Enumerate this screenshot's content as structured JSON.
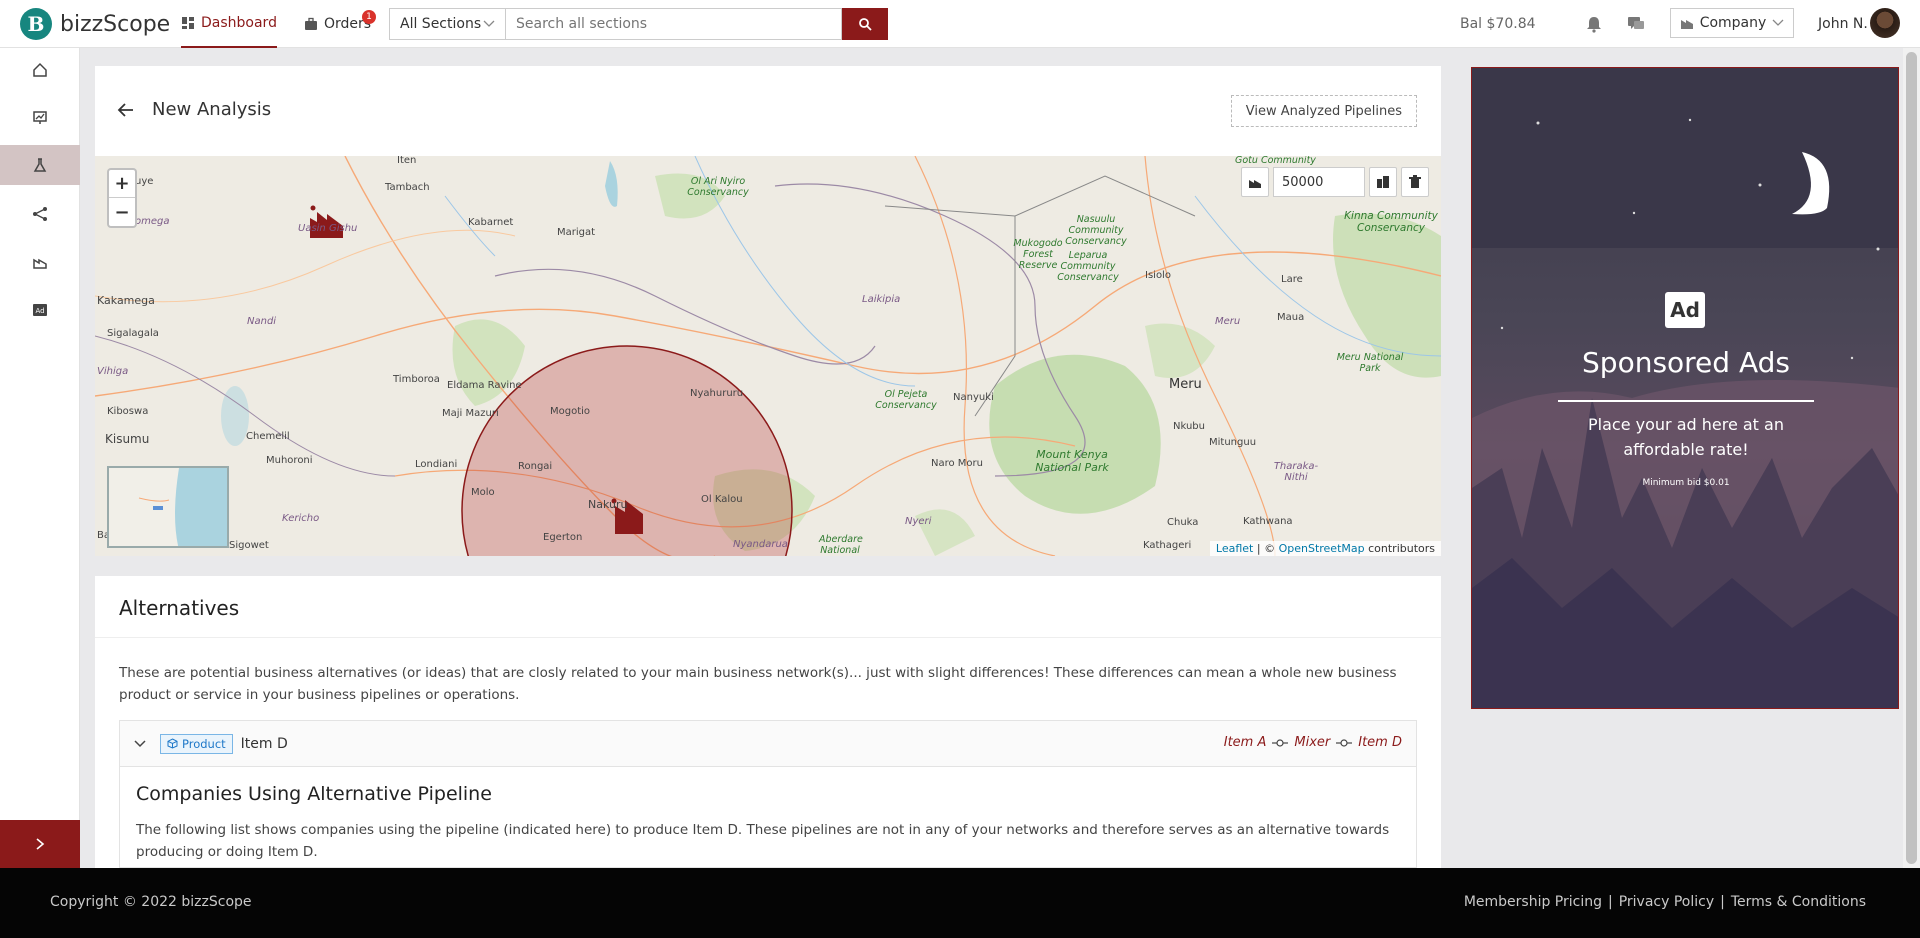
{
  "header": {
    "brand": "bizzScope",
    "brand_initial": "B",
    "nav": [
      {
        "label": "Dashboard",
        "icon": "dashboard-icon",
        "active": true
      },
      {
        "label": "Orders",
        "icon": "briefcase-icon",
        "badge": "1"
      }
    ],
    "search": {
      "section_label": "All Sections",
      "placeholder": "Search all sections"
    },
    "balance": "Bal $70.84",
    "company_label": "Company",
    "user_name": "John N."
  },
  "sidebar": {
    "items": [
      {
        "icon": "home-icon"
      },
      {
        "icon": "presentation-icon"
      },
      {
        "icon": "flask-icon",
        "active": true
      },
      {
        "icon": "network-icon"
      },
      {
        "icon": "factory-icon"
      },
      {
        "icon": "ad-icon"
      }
    ]
  },
  "page": {
    "title": "New Analysis",
    "view_button": "View Analyzed Pipelines"
  },
  "map": {
    "zoom_in": "+",
    "zoom_out": "−",
    "radius_value": "50000",
    "attribution_leaflet": "Leaflet",
    "attribution_sep": " | © ",
    "attribution_osm": "OpenStreetMap",
    "attribution_tail": " contributors",
    "labels": {
      "iten": "Iten",
      "tambach": "Tambach",
      "kabarnet": "Kabarnet",
      "marigat": "Marigat",
      "uasin": "Uasin Gishu",
      "kakamega": "Kakamega",
      "sigalagala": "Sigalagala",
      "nandi": "Nandi",
      "vihiga": "Vihiga",
      "kiboswa": "Kiboswa",
      "kisumu": "Kisumu",
      "chemelil": "Chemelil",
      "muhoroni": "Muhoroni",
      "kericho": "Kericho",
      "sigowet": "Sigowet",
      "timboroa": "Timboroa",
      "eldama": "Eldama Ravine",
      "maji": "Maji Mazuri",
      "mogotio": "Mogotio",
      "londiani": "Londiani",
      "rongai": "Rongai",
      "molo": "Molo",
      "nakuru": "Nakuru",
      "egerton": "Egerton",
      "nyahururu": "Nyahururu",
      "olkalou": "Ol Kalou",
      "nyandarua": "Nyandarua",
      "aberdare": "Aberdare National",
      "laikipia": "Laikipia",
      "olpejeta": "Ol Pejeta Conservancy",
      "nanyuki": "Nanyuki",
      "naromoru": "Naro Moru",
      "mountkenya": "Mount Kenya National Park",
      "nyeri": "Nyeri",
      "nkubu": "Nkubu",
      "meru": "Meru",
      "meru_region": "Meru",
      "mitunguu": "Mitunguu",
      "chuka": "Chuka",
      "kathwana": "Kathwana",
      "kathageri": "Kathageri",
      "tharaka": "Tharaka-Nithi",
      "isiolo": "Isiolo",
      "lare": "Lare",
      "maua": "Maua",
      "merupark": "Meru National Park",
      "kinna": "Kinna Community Conservancy",
      "gotu": "Gotu Community",
      "mukogodo": "Mukogodo Forest Reserve",
      "nasuulu": "Nasuulu Community Conservancy",
      "leparua": "Leparua Community Conservancy",
      "olarinyiro": "Ol Ari Nyiro Conservancy",
      "uye": "uye",
      "omega": "omega",
      "ba": "Ba"
    }
  },
  "alternatives": {
    "title": "Alternatives",
    "description": "These are potential business alternatives (or ideas) that are closly related to your main business network(s)... just with slight differences! These differences can mean a whole new business product or service in your business pipelines or operations.",
    "item": {
      "tag": "Product",
      "name": "Item D",
      "pipeline": [
        "Item A",
        "Mixer",
        "Item D"
      ]
    },
    "companies_title": "Companies Using Alternative Pipeline",
    "companies_desc": "The following list shows companies using the pipeline (indicated here) to produce Item D. These pipelines are not in any of your networks and therefore serves as an alternative towards producing or doing Item D."
  },
  "ad": {
    "badge": "Ad",
    "title": "Sponsored Ads",
    "subtitle_line1": "Place your ad here at an",
    "subtitle_line2": "affordable rate!",
    "min_bid": "Minimum bid $0.01"
  },
  "footer": {
    "copyright": "Copyright © 2022 bizzScope",
    "links": [
      "Membership Pricing",
      "|",
      "Privacy Policy",
      "|",
      "Terms & Conditions"
    ]
  },
  "colors": {
    "brand_red": "#8b1a1a",
    "brand_teal": "#17867f",
    "product_blue": "#1f78c8"
  }
}
